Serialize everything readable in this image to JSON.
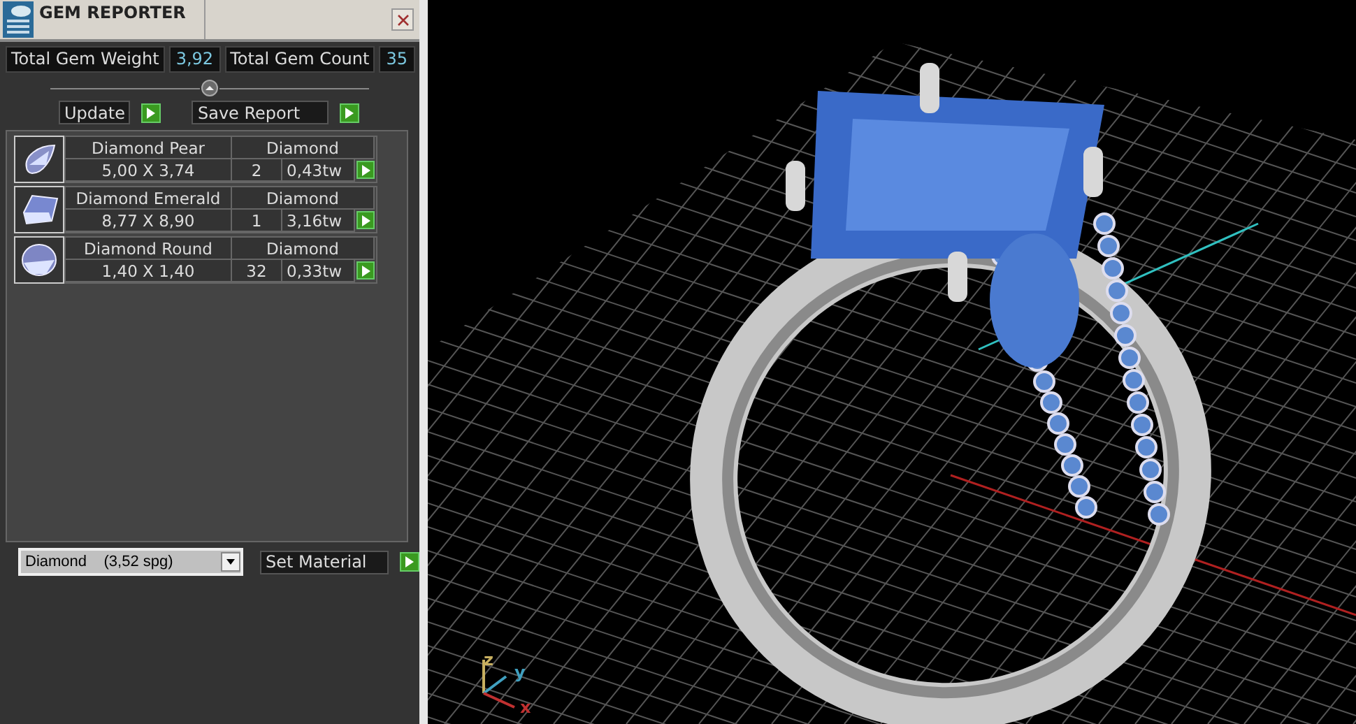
{
  "window": {
    "title": "GEM REPORTER"
  },
  "totals": [
    {
      "label": "Total Gem Weight",
      "value": "3,92"
    },
    {
      "label": "Total Gem Count",
      "value": "35"
    }
  ],
  "buttons": [
    {
      "label": "Update"
    },
    {
      "label": "Save Report"
    }
  ],
  "gems": [
    {
      "kind": "pear",
      "name": "Diamond Pear",
      "material": "Diamond",
      "size": "5,00 X 3,74",
      "count": "2",
      "weight": "0,43tw"
    },
    {
      "kind": "emerald",
      "name": "Diamond Emerald",
      "material": "Diamond",
      "size": "8,77 X 8,90",
      "count": "1",
      "weight": "3,16tw"
    },
    {
      "kind": "round",
      "name": "Diamond Round",
      "material": "Diamond",
      "size": "1,40 X 1,40",
      "count": "32",
      "weight": "0,33tw"
    }
  ],
  "material_select": {
    "value": "Diamond    (3,52 spg)"
  },
  "set_material_button": {
    "label": "Set Material"
  },
  "viewport": {
    "axes": [
      {
        "label": "z",
        "color": "#c8b060"
      },
      {
        "label": "y",
        "color": "#40a0c0"
      },
      {
        "label": "x",
        "color": "#c03030"
      }
    ]
  }
}
